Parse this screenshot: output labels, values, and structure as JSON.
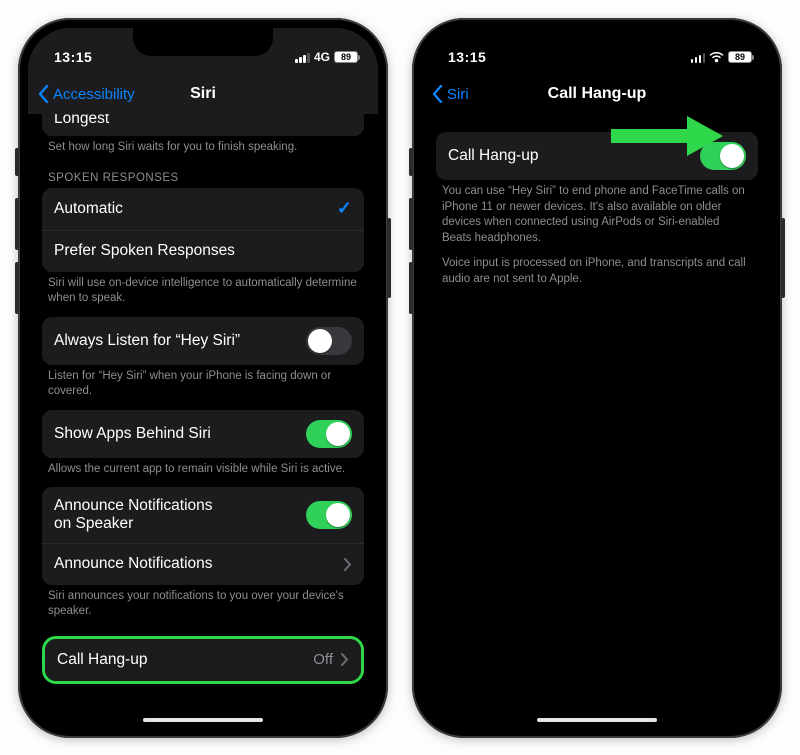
{
  "colors": {
    "accent": "#0a84ff",
    "highlight": "#2fd84a",
    "switch_on": "#30d158"
  },
  "left": {
    "status": {
      "time": "13:15",
      "network_label": "4G",
      "battery": "89"
    },
    "nav": {
      "back": "Accessibility",
      "title": "Siri"
    },
    "truncated_row": "Longest",
    "truncated_footer": "Set how long Siri waits for you to finish speaking.",
    "section_spoken_header": "SPOKEN RESPONSES",
    "spoken": {
      "automatic": "Automatic",
      "prefer": "Prefer Spoken Responses"
    },
    "spoken_footer": "Siri will use on-device intelligence to automatically determine when to speak.",
    "always_listen_label": "Always Listen for “Hey Siri”",
    "always_listen_footer": "Listen for “Hey Siri” when your iPhone is facing down or covered.",
    "show_apps_label": "Show Apps Behind Siri",
    "show_apps_footer": "Allows the current app to remain visible while Siri is active.",
    "announce_speaker_label": "Announce Notifications\non Speaker",
    "announce_label": "Announce Notifications",
    "announce_footer": "Siri announces your notifications to you over your device's speaker.",
    "call_hangup_label": "Call Hang-up",
    "call_hangup_value": "Off"
  },
  "right": {
    "status": {
      "time": "13:15",
      "battery": "89"
    },
    "nav": {
      "back": "Siri",
      "title": "Call Hang-up"
    },
    "row_label": "Call Hang-up",
    "footer1": "You can use “Hey Siri” to end phone and FaceTime calls on iPhone 11 or newer devices. It's also available on older devices when connected using AirPods or Siri-enabled Beats headphones.",
    "footer2": "Voice input is processed on iPhone, and transcripts and call audio are not sent to Apple."
  }
}
